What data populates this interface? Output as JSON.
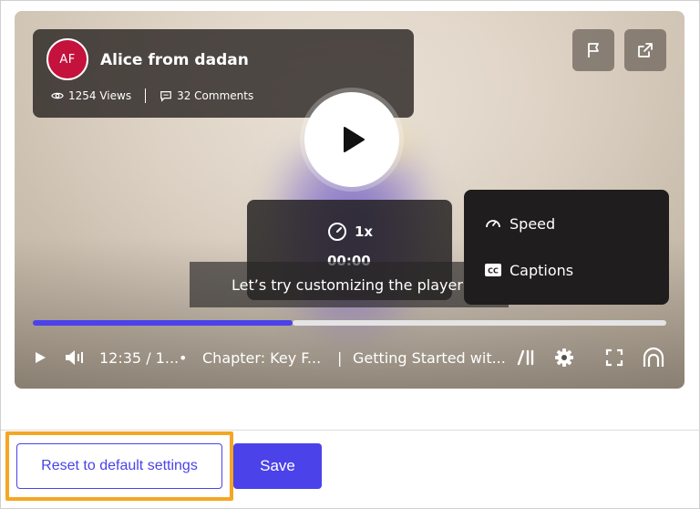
{
  "author": {
    "initials": "AF",
    "name": "Alice from dadan",
    "views": "1254 Views",
    "comments": "32 Comments"
  },
  "speed_overlay": {
    "speed": "1x",
    "time": "00:00"
  },
  "caption": "Let’s try customizing the player",
  "settings_menu": {
    "items": [
      {
        "label": "Speed",
        "icon": "gauge-icon"
      },
      {
        "label": "Captions",
        "icon": "captions-icon"
      }
    ]
  },
  "progress": {
    "fraction": 0.41
  },
  "controls": {
    "time": "12:35 / 1...",
    "bullet": "•",
    "chapter": "Chapter: Key F...",
    "separator": "|",
    "title": "Getting Started wit..."
  },
  "footer": {
    "reset_label": "Reset to default settings",
    "save_label": "Save"
  },
  "colors": {
    "accent": "#4b42ea",
    "avatar": "#c4123d",
    "focus": "#f5a623"
  }
}
